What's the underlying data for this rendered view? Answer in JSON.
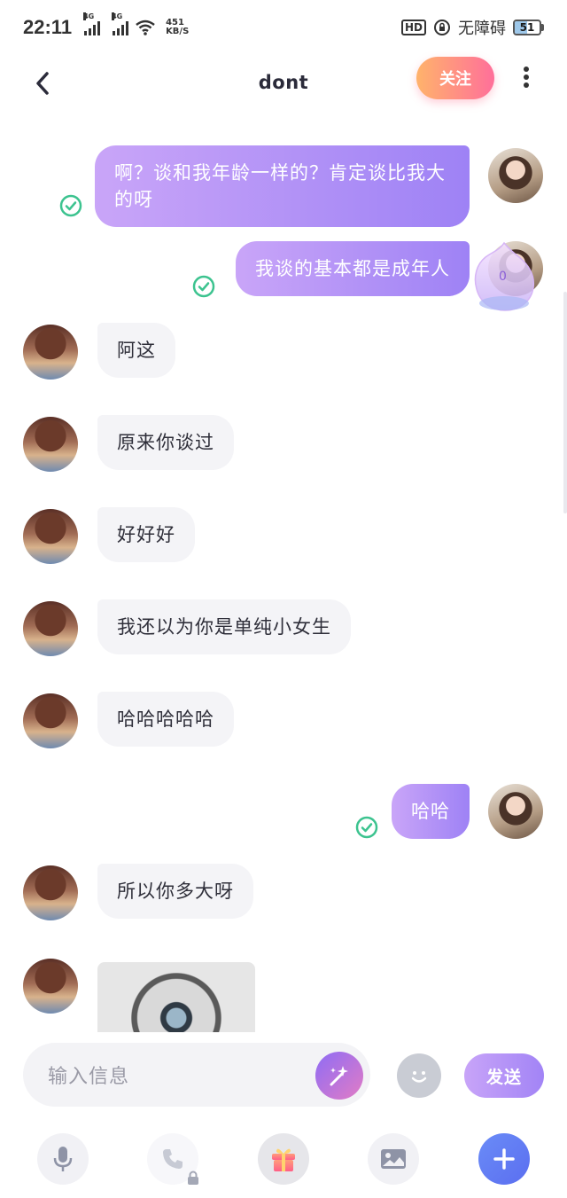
{
  "status_bar": {
    "time": "22:11",
    "signal1_label": "4G",
    "signal2_label": "4G",
    "net_speed_value": "451",
    "net_speed_unit": "KB/S",
    "hd_label": "HD",
    "accessibility_label": "无障碍",
    "battery_level": "51"
  },
  "header": {
    "title": "dont",
    "follow_label": "关注"
  },
  "messages": [
    {
      "sender": "self",
      "text": "啊？谈和我年龄一样的？肯定谈比我大的呀",
      "read": true
    },
    {
      "sender": "self",
      "text": "我谈的基本都是成年人",
      "read": true
    },
    {
      "sender": "other",
      "text": "阿这"
    },
    {
      "sender": "other",
      "text": "原来你谈过"
    },
    {
      "sender": "other",
      "text": "好好好"
    },
    {
      "sender": "other",
      "text": "我还以为你是单纯小女生"
    },
    {
      "sender": "other",
      "text": "哈哈哈哈哈"
    },
    {
      "sender": "self",
      "text": "哈哈",
      "read": true
    },
    {
      "sender": "other",
      "text": "所以你多大呀"
    },
    {
      "sender": "other",
      "type": "image"
    }
  ],
  "sticker": {
    "label": "0"
  },
  "input": {
    "placeholder": "输入信息",
    "send_label": "发送"
  },
  "toolbar": {
    "items": [
      "microphone-icon",
      "phone-icon",
      "gift-icon",
      "image-icon",
      "plus-icon"
    ]
  },
  "colors": {
    "self_bubble_start": "#c9a5f8",
    "self_bubble_end": "#9e82f5",
    "other_bubble": "#f4f4f7",
    "read_check": "#3cc38f",
    "follow_start": "#ffb36b",
    "follow_end": "#ff6f9a",
    "plus_button": "#5b6ef0"
  }
}
